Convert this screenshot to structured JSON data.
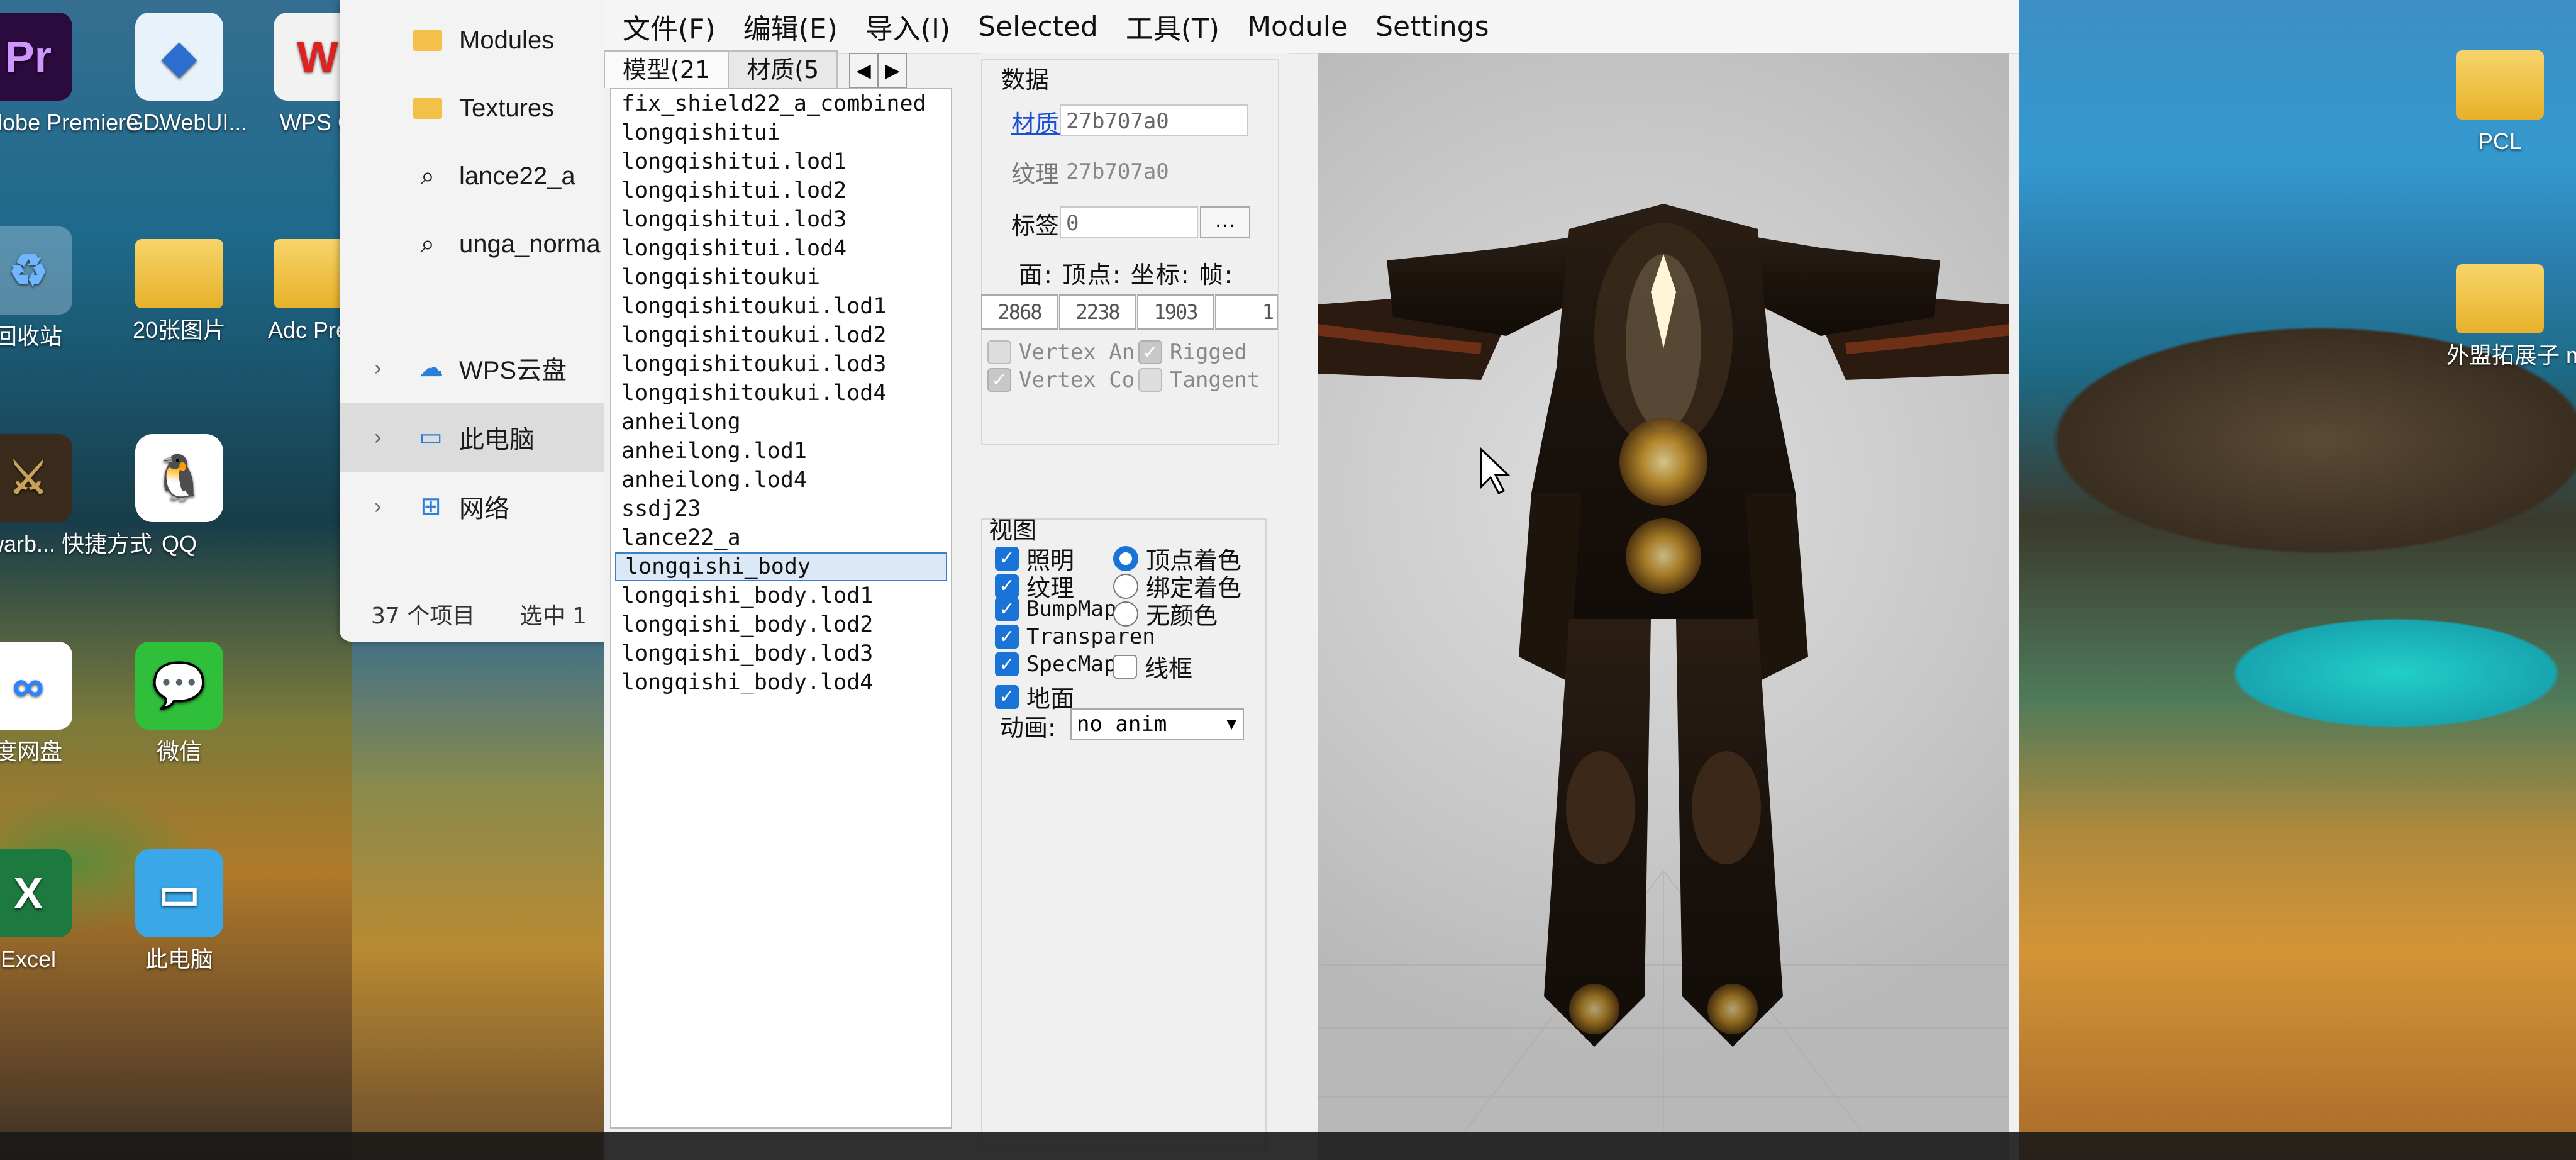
{
  "desktop": {
    "icons_left": [
      {
        "name": "premiere-icon",
        "label": "Adobe Premiere ...",
        "glyph": "Pr",
        "cls": "pr"
      },
      {
        "name": "recycle-bin-icon",
        "label": "回收站",
        "glyph": "♻",
        "cls": "recycle"
      },
      {
        "name": "warband-shortcut-icon",
        "label": "_warb... 快捷方式",
        "glyph": "⚔",
        "cls": "game"
      },
      {
        "name": "baidu-netdisk-icon",
        "label": "度网盘",
        "glyph": "∞",
        "cls": "baidu"
      },
      {
        "name": "excel-icon",
        "label": "Excel",
        "glyph": "X",
        "cls": "excel"
      }
    ],
    "icons_col2": [
      {
        "name": "gdwebui-icon",
        "label": "GDWebUI...",
        "glyph": "◆",
        "cls": "gdweb"
      },
      {
        "name": "folder-20-images-icon",
        "label": "20张图片",
        "glyph": "",
        "cls": "folder"
      },
      {
        "name": "qq-icon",
        "label": "QQ",
        "glyph": "🐧",
        "cls": "qq"
      },
      {
        "name": "wechat-icon",
        "label": "微信",
        "glyph": "💬",
        "cls": "wechat"
      },
      {
        "name": "this-pc-icon",
        "label": "此电脑",
        "glyph": "▭",
        "cls": "pc"
      }
    ],
    "icons_col3": [
      {
        "name": "wps-icon",
        "label": "WPS O",
        "glyph": "W",
        "cls": "wps"
      },
      {
        "name": "adobe-premiere2-icon",
        "label": "Adc Prem",
        "glyph": "",
        "cls": "folder"
      }
    ],
    "icons_right": [
      {
        "name": "pcl-folder-icon",
        "label": "PCL",
        "glyph": "",
        "cls": "folder"
      },
      {
        "name": "external-extension-folder-icon",
        "label": "外盟拓展子 mod（基...",
        "glyph": "",
        "cls": "folder"
      }
    ]
  },
  "explorer": {
    "items": [
      {
        "label": "Modules",
        "icon": "folder"
      },
      {
        "label": "Textures",
        "icon": "folder"
      },
      {
        "label": "lance22_a",
        "icon": "search"
      },
      {
        "label": "unga_norma",
        "icon": "search"
      }
    ],
    "nav": [
      {
        "label": "WPS云盘",
        "icon": "☁"
      },
      {
        "label": "此电脑",
        "icon": "▭"
      },
      {
        "label": "网络",
        "icon": "⊞"
      }
    ],
    "status_count": "37 个项目",
    "status_selected": "选中 1"
  },
  "menu": [
    "文件(F)",
    "编辑(E)",
    "导入(I)",
    "Selected",
    "工具(T)",
    "Module",
    "Settings"
  ],
  "tabs": {
    "models": "模型(21",
    "materials": "材质(5",
    "left": "◀",
    "right": "▶"
  },
  "models": [
    "fix_shield22_a_combined",
    "longqishitui",
    "longqishitui.lod1",
    "longqishitui.lod2",
    "longqishitui.lod3",
    "longqishitui.lod4",
    "longqishitoukui",
    "longqishitoukui.lod1",
    "longqishitoukui.lod2",
    "longqishitoukui.lod3",
    "longqishitoukui.lod4",
    "anheilong",
    "anheilong.lod1",
    "anheilong.lod4",
    "ssdj23",
    "lance22_a",
    "longqishi_body",
    "longqishi_body.lod1",
    "longqishi_body.lod2",
    "longqishi_body.lod3",
    "longqishi_body.lod4"
  ],
  "selected_model_index": 16,
  "data_panel": {
    "title": "数据",
    "material_label": "材质:",
    "material_value": "27b707a0",
    "texture_label": "纹理:",
    "texture_value": "27b707a0",
    "tag_label": "标签:",
    "tag_value": "0",
    "tag_button": "...",
    "stats_header": "面: 顶点: 坐标:   帧:",
    "faces": "2868",
    "vertices": "2238",
    "coords": "1903",
    "frames": "1",
    "flags": [
      {
        "label": "Vertex An",
        "state": "dis"
      },
      {
        "label": "Rigged",
        "state": "dis-on"
      },
      {
        "label": "Vertex Co",
        "state": "dis-on"
      },
      {
        "label": "Tangent",
        "state": "dis"
      }
    ]
  },
  "view_panel": {
    "title": "视图",
    "checks": [
      {
        "label": "照明",
        "zh": true
      },
      {
        "label": "纹理",
        "zh": true
      },
      {
        "label": "BumpMap",
        "zh": false
      },
      {
        "label": "Transparen",
        "zh": false
      },
      {
        "label": "SpecMap",
        "zh": false
      },
      {
        "label": "地面",
        "zh": true
      }
    ],
    "radios": [
      {
        "label": "顶点着色",
        "on": true
      },
      {
        "label": "绑定着色",
        "on": false
      },
      {
        "label": "无颜色",
        "on": false
      }
    ],
    "wireframe_label": "线框",
    "anim_label": "动画:",
    "anim_value": "no anim"
  }
}
